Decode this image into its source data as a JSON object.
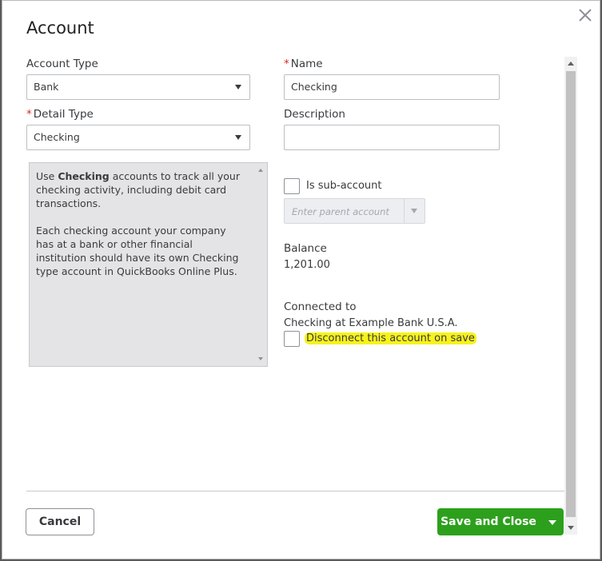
{
  "dialog": {
    "title": "Account",
    "close_icon": "close-icon"
  },
  "account_type": {
    "label": "Account Type",
    "value": "Bank"
  },
  "detail_type": {
    "required_mark": "*",
    "label": "Detail Type",
    "value": "Checking"
  },
  "name": {
    "required_mark": "*",
    "label": "Name",
    "value": "Checking"
  },
  "description": {
    "label": "Description",
    "value": ""
  },
  "detail_description": {
    "intro_prefix": "Use ",
    "intro_bold": "Checking",
    "intro_suffix": " accounts to track all your checking activity, including debit card transactions.",
    "paragraph2": "Each checking account your company has at a bank or other financial institution should have its own Checking type account in QuickBooks Online Plus."
  },
  "sub_account": {
    "label": "Is sub-account",
    "checked": false,
    "parent_placeholder": "Enter parent account"
  },
  "balance": {
    "label": "Balance",
    "value": "1,201.00"
  },
  "connection": {
    "label": "Connected to",
    "value": "Checking at Example Bank U.S.A.",
    "disconnect_label": "Disconnect this account on save",
    "highlight_color": "#f7f21d"
  },
  "footer": {
    "cancel_label": "Cancel",
    "save_label": "Save and Close",
    "save_color": "#2ca01c"
  }
}
